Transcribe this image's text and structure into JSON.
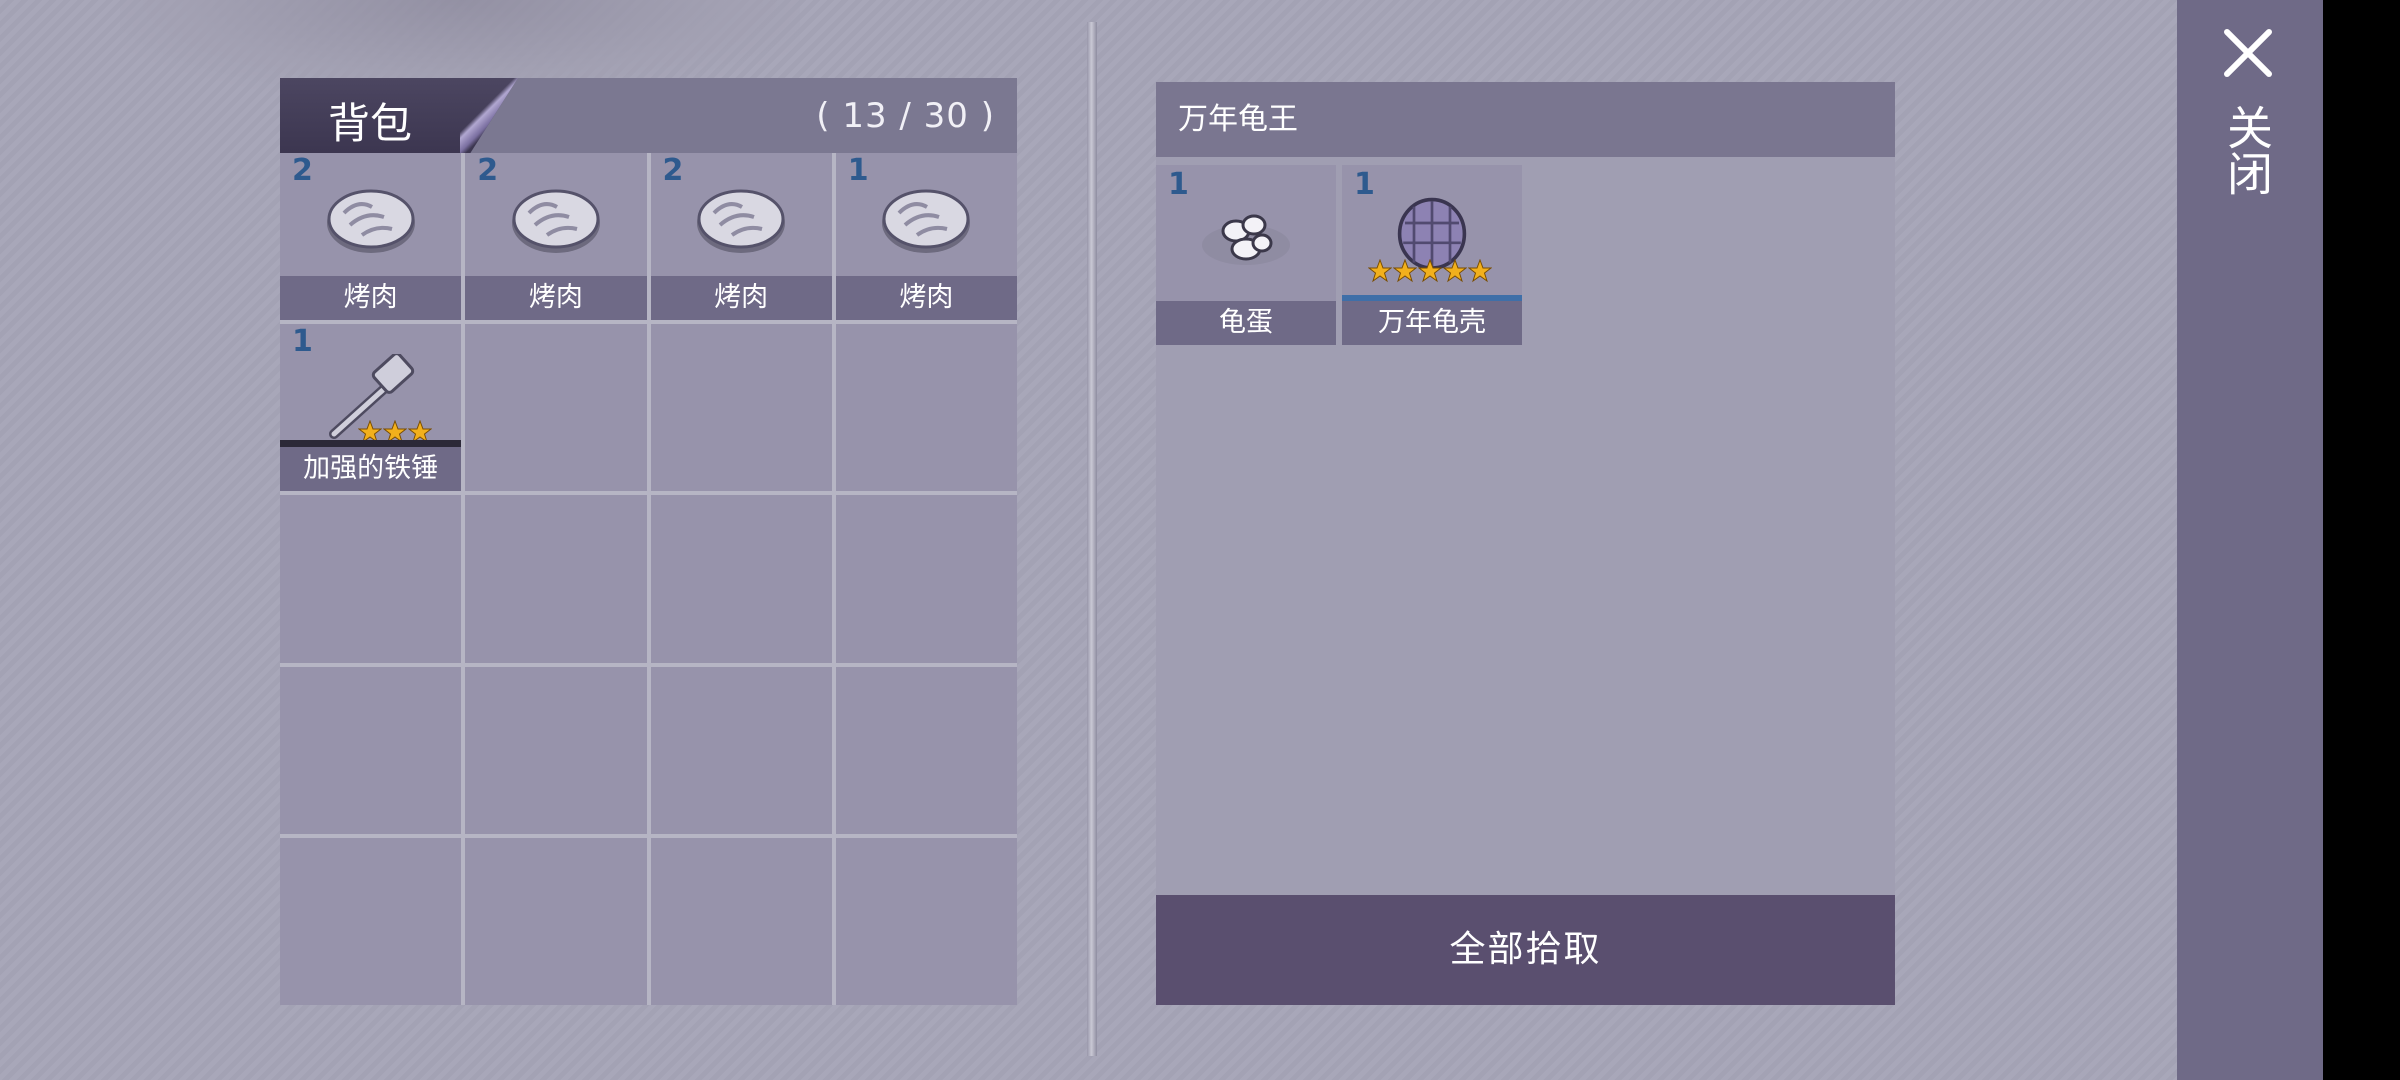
{
  "backpack": {
    "title": "背包",
    "count": "( 13 / 30 )",
    "slots": [
      {
        "qty": "2",
        "name": "烤肉",
        "icon": "roast-meat-icon"
      },
      {
        "qty": "2",
        "name": "烤肉",
        "icon": "roast-meat-icon"
      },
      {
        "qty": "2",
        "name": "烤肉",
        "icon": "roast-meat-icon"
      },
      {
        "qty": "1",
        "name": "烤肉",
        "icon": "roast-meat-icon"
      },
      {
        "qty": "1",
        "name": "加强的铁锤",
        "icon": "iron-hammer-icon",
        "stars": 3
      }
    ]
  },
  "loot": {
    "title": "万年龟王",
    "items": [
      {
        "qty": "1",
        "name": "龟蛋",
        "icon": "turtle-egg-icon"
      },
      {
        "qty": "1",
        "name": "万年龟壳",
        "icon": "turtle-shell-icon",
        "stars": 5
      }
    ],
    "pickup_all_label": "全部拾取"
  },
  "sidebar": {
    "close_label": "关闭"
  },
  "colors": {
    "qty_text": "#2e5a8e",
    "star": "#f2b01c",
    "button": "#5a4f6f"
  }
}
